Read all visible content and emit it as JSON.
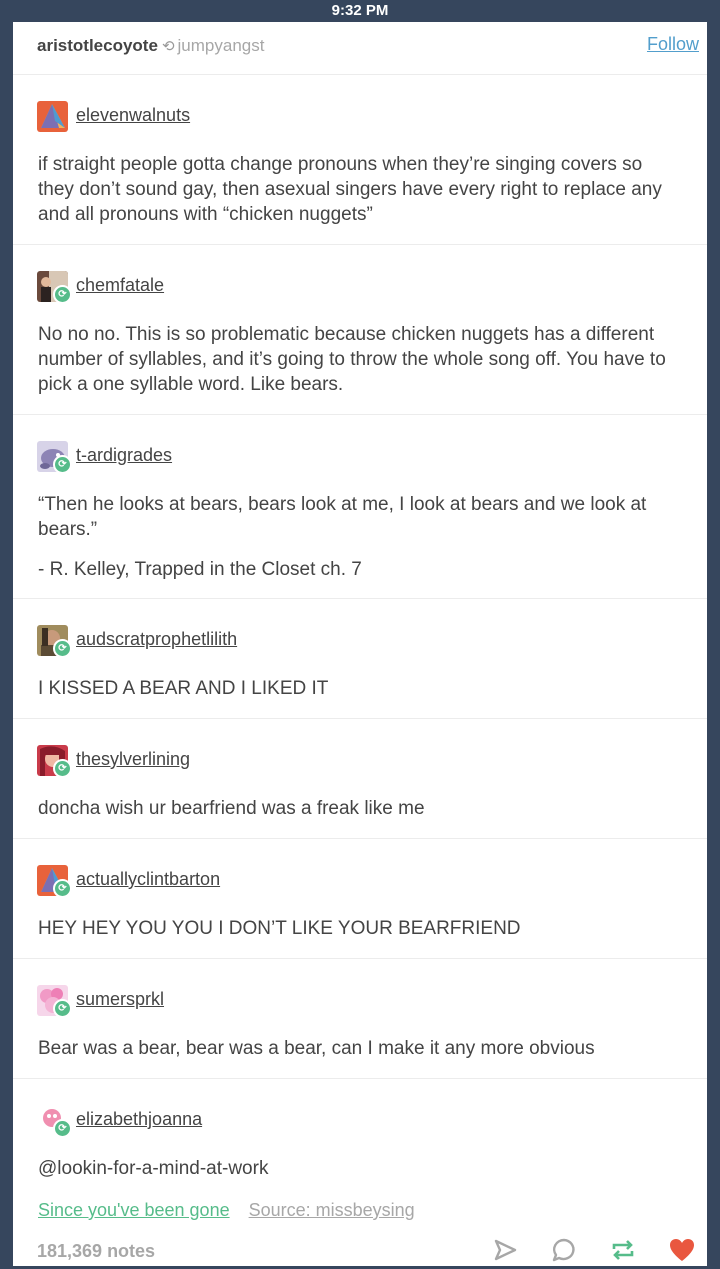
{
  "status_bar": {
    "time": "9:32 PM"
  },
  "header": {
    "author": "aristotlecoyote",
    "reblogged_from": "jumpyangst",
    "follow_label": "Follow"
  },
  "trail": [
    {
      "username": "elevenwalnuts",
      "lines": [
        "if straight people gotta change pronouns when they’re singing covers so they don’t sound gay, then asexual singers have every right to replace any and all pronouns with “chicken nuggets”"
      ]
    },
    {
      "username": "chemfatale",
      "lines": [
        "No no no. This is so problematic because chicken nuggets has a different number of syllables, and it’s going to throw the whole song off. You have to pick a one syllable word. Like bears."
      ]
    },
    {
      "username": "t-ardigrades",
      "lines": [
        " “Then he looks at bears, bears look at me, I look at bears and we look at bears.”",
        "- R. Kelley, Trapped in the Closet ch. 7"
      ]
    },
    {
      "username": "audscratprophetlilith",
      "lines": [
        "I KISSED A BEAR AND I LIKED IT"
      ]
    },
    {
      "username": "thesylverlining",
      "lines": [
        "doncha wish ur bearfriend was a freak like me"
      ]
    },
    {
      "username": "actuallyclintbarton",
      "lines": [
        "HEY HEY YOU YOU I DON’T LIKE YOUR BEARFRIEND"
      ]
    },
    {
      "username": "sumersprkl",
      "lines": [
        "Bear was a bear, bear was a bear, can I make it any more obvious"
      ]
    },
    {
      "username": "elizabethjoanna",
      "lines": [
        "@lookin-for-a-mind-at-work"
      ]
    }
  ],
  "footer": {
    "song_link": "Since you've been gone",
    "source_link": "Source: missbeysing",
    "notes": "181,369 notes"
  },
  "colors": {
    "background": "#36465d",
    "link": "#529ecc",
    "reblog_green": "#56bc8a",
    "like_red": "#e9573f",
    "text": "#444444",
    "muted": "#a7a7a7"
  },
  "icons": [
    "reblog-icon",
    "share-icon",
    "reply-icon",
    "reblog-action-icon",
    "heart-icon"
  ]
}
